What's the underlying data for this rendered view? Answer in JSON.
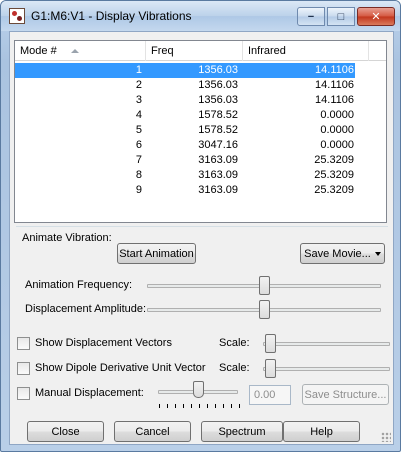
{
  "window": {
    "title": "G1:M6:V1 - Display Vibrations",
    "controls": {
      "minimize": "−",
      "maximize": "□",
      "close": "✕"
    }
  },
  "table": {
    "columns": [
      "Mode #",
      "Freq",
      "Infrared"
    ],
    "sort_column": "Mode #",
    "selected_row": 0,
    "rows": [
      [
        "1",
        "1356.03",
        "14.1106"
      ],
      [
        "2",
        "1356.03",
        "14.1106"
      ],
      [
        "3",
        "1356.03",
        "14.1106"
      ],
      [
        "4",
        "1578.52",
        "0.0000"
      ],
      [
        "5",
        "1578.52",
        "0.0000"
      ],
      [
        "6",
        "3047.16",
        "0.0000"
      ],
      [
        "7",
        "3163.09",
        "25.3209"
      ],
      [
        "8",
        "3163.09",
        "25.3209"
      ],
      [
        "9",
        "3163.09",
        "25.3209"
      ]
    ]
  },
  "animate": {
    "group_label": "Animate Vibration:",
    "start_button": "Start Animation",
    "save_movie_button": "Save Movie...",
    "frequency_label": "Animation Frequency:",
    "frequency_level": 0.5,
    "amplitude_label": "Displacement Amplitude:",
    "amplitude_level": 0.5
  },
  "options": {
    "show_vectors_label": "Show Displacement Vectors",
    "show_vectors_checked": false,
    "show_dipole_label": "Show Dipole Derivative Unit Vector",
    "show_dipole_checked": false,
    "scale_label": "Scale:",
    "manual_label": "Manual Displacement:",
    "manual_checked": false,
    "manual_value": "0.00",
    "save_structure_button": "Save Structure..."
  },
  "footer": {
    "close": "Close",
    "cancel": "Cancel",
    "spectrum": "Spectrum",
    "help": "Help"
  },
  "colors": {
    "selection": "#3399ff",
    "title_bar": "#bcd2ea",
    "close_button": "#c2351c"
  }
}
